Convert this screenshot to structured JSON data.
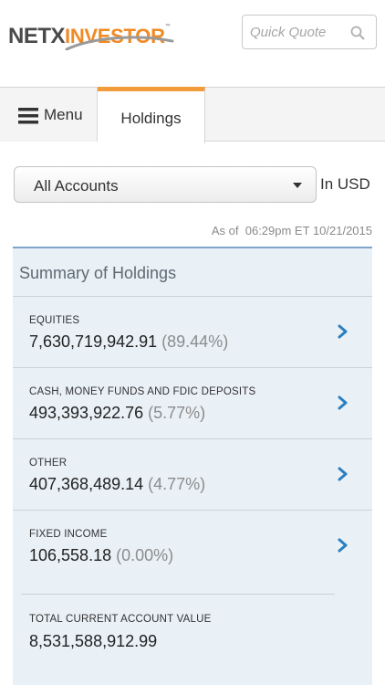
{
  "brand": {
    "part1": "NETX",
    "part2": "INVESTOR",
    "tm": "™"
  },
  "quick_quote": {
    "placeholder": "Quick Quote"
  },
  "tabs": [
    {
      "label": "Menu"
    },
    {
      "label": "Holdings"
    }
  ],
  "account_select": {
    "selected": "All Accounts"
  },
  "currency": "In USD",
  "as_of": {
    "prefix": "As of",
    "time": "06:29pm ET 10/21/2015"
  },
  "summary": {
    "title": "Summary of Holdings",
    "rows": [
      {
        "category": "EQUITIES",
        "value": "7,630,719,942.91",
        "pct": "(89.44%)"
      },
      {
        "category": "CASH, MONEY FUNDS AND FDIC DEPOSITS",
        "value": "493,393,922.76",
        "pct": "(5.77%)"
      },
      {
        "category": "OTHER",
        "value": "407,368,489.14",
        "pct": "(4.77%)"
      },
      {
        "category": "FIXED INCOME",
        "value": "106,558.18",
        "pct": "(0.00%)"
      }
    ],
    "total": {
      "category": "TOTAL CURRENT ACCOUNT VALUE",
      "value": "8,531,588,912.99"
    }
  },
  "colors": {
    "accent": "#f39c3c",
    "panel": "#e9f0f6",
    "chevron": "#2a7fc1",
    "panel_border": "#7ea6cc"
  }
}
